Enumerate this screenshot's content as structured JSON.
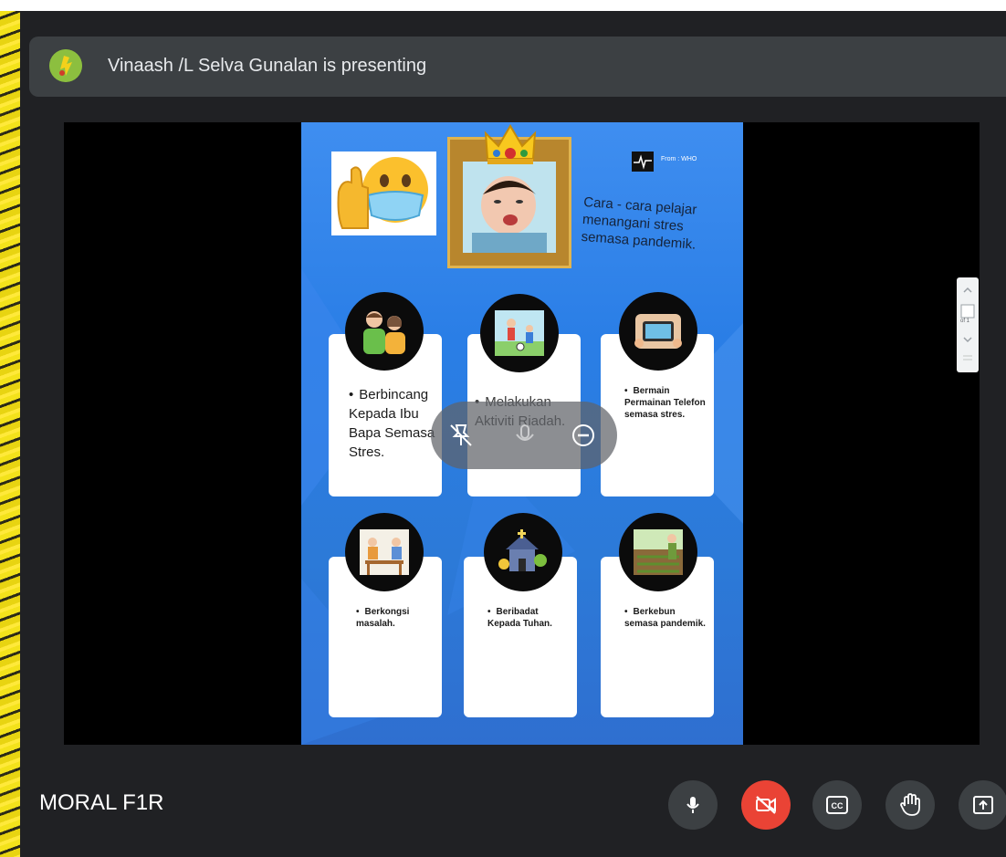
{
  "presenter": {
    "banner_text": "Vinaash /L Selva Gunalan is presenting",
    "avatar_icon": "presenter-avatar"
  },
  "slide": {
    "source_label": "From : WHO",
    "title": "Cara - cara pelajar menangani stres semasa pandemik.",
    "cards": [
      {
        "text": "Berbincang Kepada Ibu Bapa Semasa Stres.",
        "icon": "family-icon"
      },
      {
        "text": "Melakukan Aktiviti Riadah.",
        "icon": "exercise-icon"
      },
      {
        "text": "Bermain Permainan Telefon semasa stres.",
        "icon": "phone-game-icon"
      },
      {
        "text": "Berkongsi masalah.",
        "icon": "conversation-icon"
      },
      {
        "text": "Beribadat Kepada Tuhan.",
        "icon": "church-icon"
      },
      {
        "text": "Berkebun semasa pandemik.",
        "icon": "garden-icon"
      }
    ]
  },
  "scroll": {
    "page_indicator": "of 1"
  },
  "meeting": {
    "name": "MORAL F1R"
  },
  "controls": [
    {
      "name": "microphone",
      "icon": "mic-icon"
    },
    {
      "name": "camera-off",
      "icon": "video-off-icon",
      "color": "#ea4335"
    },
    {
      "name": "captions",
      "icon": "cc-icon"
    },
    {
      "name": "raise-hand",
      "icon": "hand-icon"
    },
    {
      "name": "present",
      "icon": "present-icon"
    }
  ],
  "colors": {
    "background": "#202124",
    "banner": "#3c4043",
    "slide_blue": "#2a7ee6",
    "camera_off_red": "#ea4335"
  }
}
